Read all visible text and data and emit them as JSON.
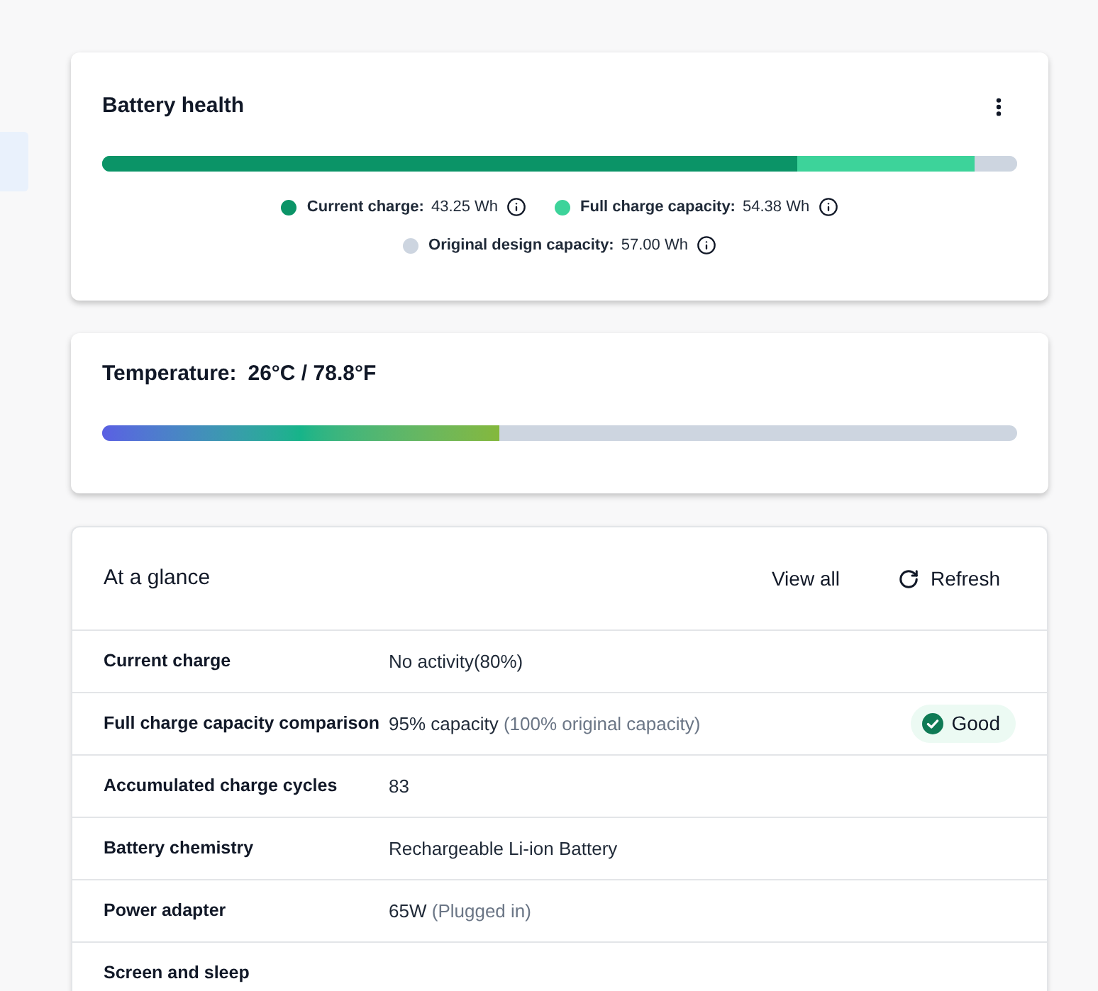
{
  "sidebar": {
    "items": [
      {
        "selected": true
      }
    ]
  },
  "battery_health": {
    "title": "Battery health",
    "segments": [
      {
        "label": "Current charge:",
        "value": "43.25 Wh",
        "color": "#0b9467",
        "level": 0.759
      },
      {
        "label": "Full charge capacity:",
        "value": "54.38 Wh",
        "color": "#3dd39a",
        "level": 0.954
      },
      {
        "label": "Original design capacity:",
        "value": "57.00 Wh",
        "color": "#cdd5e0",
        "level": 1
      }
    ]
  },
  "temperature": {
    "label": "Temperature:",
    "value": "26°C / 78.8°F",
    "level": 0.434
  },
  "at_a_glance": {
    "title": "At a glance",
    "actions": [
      {
        "label": "View all",
        "kind": "link"
      },
      {
        "label": "Refresh",
        "kind": "refresh"
      }
    ],
    "rows": [
      {
        "label": "Current charge",
        "value": "No activity(80%)"
      },
      {
        "label": "Full charge capacity comparison",
        "value": "95% capacity",
        "note": "(100% original capacity)",
        "badge": "Good"
      },
      {
        "label": "Accumulated charge cycles",
        "value": "83"
      },
      {
        "label": "Battery chemistry",
        "value": "Rechargeable Li-ion Battery"
      },
      {
        "label": "Power adapter",
        "value": "65W",
        "note": "(Plugged in)"
      },
      {
        "label": "Screen and sleep"
      }
    ]
  }
}
